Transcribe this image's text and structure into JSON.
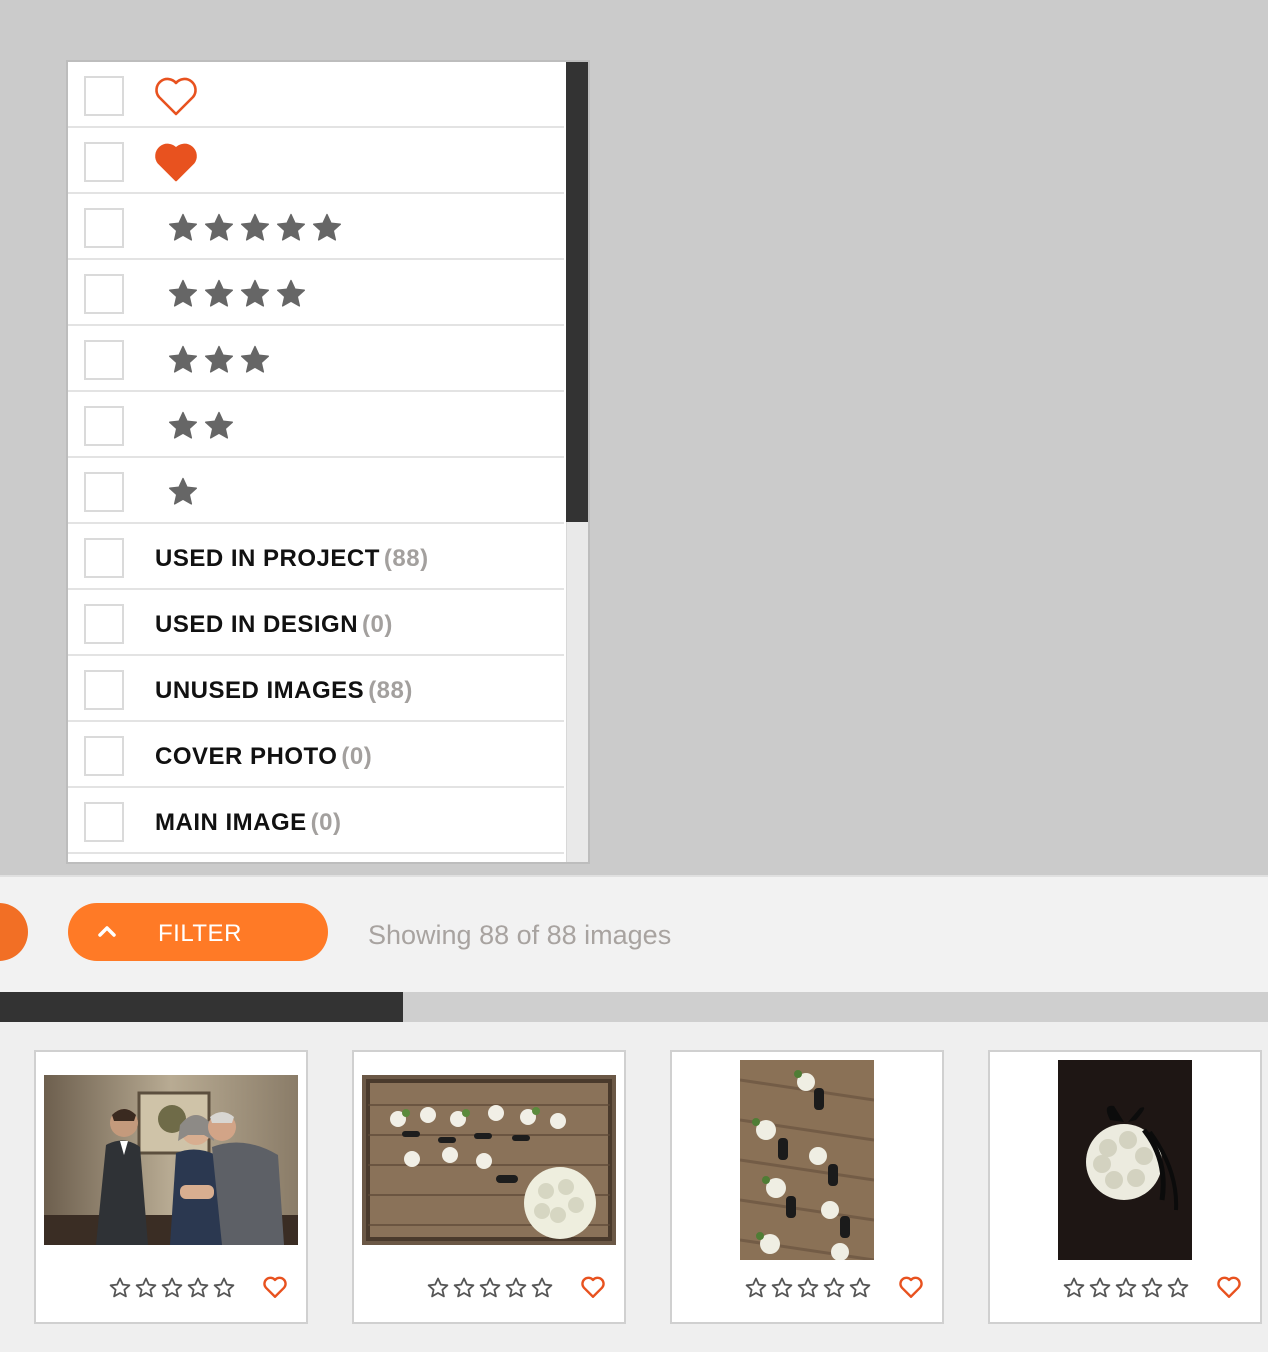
{
  "filter_panel": {
    "rows": [
      {
        "kind": "heart-outline"
      },
      {
        "kind": "heart-filled"
      },
      {
        "kind": "stars",
        "count": 5
      },
      {
        "kind": "stars",
        "count": 4
      },
      {
        "kind": "stars",
        "count": 3
      },
      {
        "kind": "stars",
        "count": 2
      },
      {
        "kind": "stars",
        "count": 1
      },
      {
        "kind": "label",
        "label": "USED IN PROJECT",
        "count": "(88)"
      },
      {
        "kind": "label",
        "label": "USED IN DESIGN",
        "count": "(0)"
      },
      {
        "kind": "label",
        "label": "UNUSED IMAGES",
        "count": "(88)"
      },
      {
        "kind": "label",
        "label": "COVER PHOTO",
        "count": "(0)"
      },
      {
        "kind": "label",
        "label": "MAIN IMAGE",
        "count": "(0)"
      }
    ]
  },
  "toolbar": {
    "filter_label": "FILTER",
    "showing_text": "Showing 88 of 88 images"
  },
  "progress": {
    "fraction": 0.318
  },
  "thumbnails": [
    {
      "rating": 0,
      "favorite": false
    },
    {
      "rating": 0,
      "favorite": false
    },
    {
      "rating": 0,
      "favorite": false
    },
    {
      "rating": 0,
      "favorite": false
    }
  ],
  "colors": {
    "accent": "#ff7a26",
    "heart": "#e8521f",
    "star": "#666666"
  },
  "icons": {
    "heart_outline": "heart-outline-icon",
    "heart_filled": "heart-filled-icon",
    "star": "star-icon",
    "chevron": "chevron-up-icon"
  }
}
